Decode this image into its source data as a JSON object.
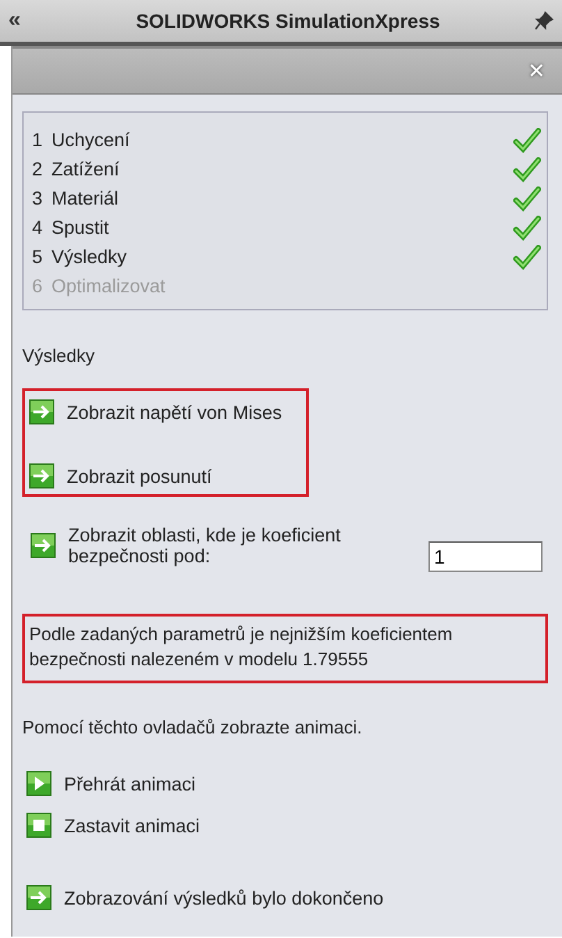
{
  "window": {
    "title": "SOLIDWORKS SimulationXpress",
    "collapse_glyph": "«"
  },
  "header": {
    "close_glyph": "✕"
  },
  "steps": [
    {
      "number": "1",
      "label": "Uchycení",
      "done": true,
      "disabled": false
    },
    {
      "number": "2",
      "label": "Zatížení",
      "done": true,
      "disabled": false
    },
    {
      "number": "3",
      "label": "Materiál",
      "done": true,
      "disabled": false
    },
    {
      "number": "4",
      "label": "Spustit",
      "done": true,
      "disabled": false
    },
    {
      "number": "5",
      "label": "Výsledky",
      "done": true,
      "disabled": false
    },
    {
      "number": "6",
      "label": "Optimalizovat",
      "done": false,
      "disabled": true
    }
  ],
  "section_title": "Výsledky",
  "display_options": {
    "highlighted": true,
    "links": [
      {
        "label": "Zobrazit napětí von Mises",
        "kind": "arrow"
      },
      {
        "label": "Zobrazit posunutí",
        "kind": "arrow"
      }
    ]
  },
  "factor_link": {
    "label": "Zobrazit oblasti, kde je koeficient bezpečnosti pod:",
    "kind": "arrow",
    "value": "1"
  },
  "summary": {
    "text": "Podle zadaných parametrů je nejnižším koeficientem bezpečnosti nalezeném v modelu 1.79555",
    "highlighted": true
  },
  "animation_hint": "Pomocí těchto ovladačů zobrazte animaci.",
  "animation_controls": [
    {
      "label": "Přehrát animaci",
      "kind": "play"
    },
    {
      "label": "Zastavit animaci",
      "kind": "stop"
    }
  ],
  "finish_link": {
    "label": "Zobrazování výsledků bylo dokončeno",
    "kind": "arrow"
  }
}
